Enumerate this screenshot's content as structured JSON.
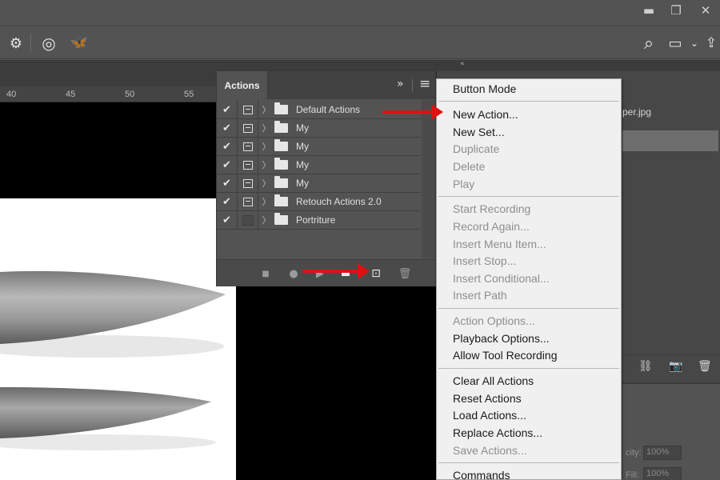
{
  "window": {
    "minimize": "▬",
    "restore": "❐",
    "close": "✕"
  },
  "optionbar": {
    "gear": "⚙",
    "aim": "◎",
    "symmetry": "🦋",
    "search": "⌕",
    "view": "▭",
    "chevron": "⌄",
    "share": "⇪"
  },
  "ruler": {
    "ticks": [
      "40",
      "45",
      "50",
      "55"
    ]
  },
  "actions": {
    "tab_label": "Actions",
    "expand_icon": "»",
    "menu_icon": "≡",
    "rows": [
      {
        "check": "✔",
        "chevron": "〉",
        "label": "Default Actions"
      },
      {
        "check": "✔",
        "chevron": "〉",
        "label": "My"
      },
      {
        "check": "✔",
        "chevron": "〉",
        "label": "My"
      },
      {
        "check": "✔",
        "chevron": "〉",
        "label": "My"
      },
      {
        "check": "✔",
        "chevron": "〉",
        "label": "My"
      },
      {
        "check": "✔",
        "chevron": "〉",
        "label": "Retouch Actions 2.0"
      },
      {
        "check": "✔",
        "chevron": "〉",
        "label": "Portriture"
      }
    ],
    "footer": {
      "stop": "■",
      "record": "●",
      "play": "▶",
      "new_set": "▬",
      "new_action": "⊡",
      "delete": "🗑"
    }
  },
  "right_panel": {
    "collapse": "«",
    "file_label": "per.jpg",
    "icons": {
      "link": "⛓",
      "camera": "📷",
      "trash": "🗑"
    },
    "opacity_label": "city:",
    "opacity_value": "100%",
    "fill_label": "Fill:",
    "fill_value": "100%"
  },
  "menu": {
    "groups": [
      [
        {
          "label": "Button Mode",
          "enabled": true
        }
      ],
      [
        {
          "label": "New Action...",
          "enabled": true
        },
        {
          "label": "New Set...",
          "enabled": true
        },
        {
          "label": "Duplicate",
          "enabled": false
        },
        {
          "label": "Delete",
          "enabled": false
        },
        {
          "label": "Play",
          "enabled": false
        }
      ],
      [
        {
          "label": "Start Recording",
          "enabled": false
        },
        {
          "label": "Record Again...",
          "enabled": false
        },
        {
          "label": "Insert Menu Item...",
          "enabled": false
        },
        {
          "label": "Insert Stop...",
          "enabled": false
        },
        {
          "label": "Insert Conditional...",
          "enabled": false
        },
        {
          "label": "Insert Path",
          "enabled": false
        }
      ],
      [
        {
          "label": "Action Options...",
          "enabled": false
        },
        {
          "label": "Playback Options...",
          "enabled": true
        },
        {
          "label": "Allow Tool Recording",
          "enabled": true
        }
      ],
      [
        {
          "label": "Clear All Actions",
          "enabled": true
        },
        {
          "label": "Reset Actions",
          "enabled": true
        },
        {
          "label": "Load Actions...",
          "enabled": true
        },
        {
          "label": "Replace Actions...",
          "enabled": true
        },
        {
          "label": "Save Actions...",
          "enabled": false
        }
      ],
      [
        {
          "label": "Commands",
          "enabled": true
        }
      ]
    ]
  },
  "colors": {
    "accent_arrow": "#e01010",
    "menu_bg": "#f0f0f0",
    "panel_bg": "#535353"
  }
}
